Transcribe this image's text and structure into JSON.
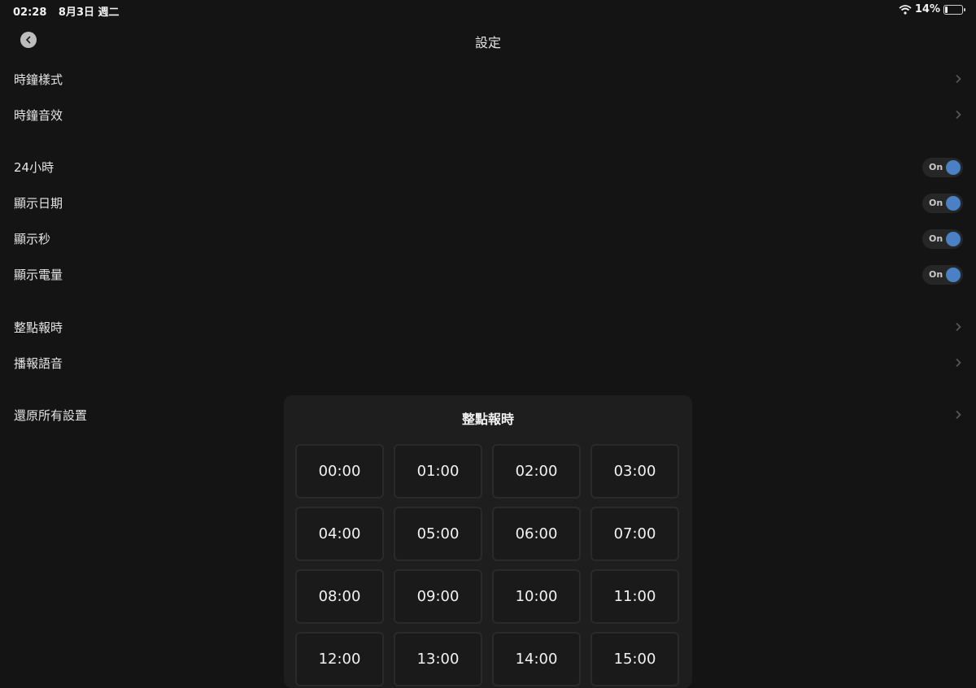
{
  "status": {
    "time": "02:28",
    "date": "8月3日 週二",
    "battery_text": "14%",
    "battery_level": 0.14
  },
  "header": {
    "title": "設定"
  },
  "settings": {
    "clock_style": "時鐘樣式",
    "clock_sound": "時鐘音效",
    "hour24": {
      "label": "24小時",
      "state": "On"
    },
    "show_date": {
      "label": "顯示日期",
      "state": "On"
    },
    "show_seconds": {
      "label": "顯示秒",
      "state": "On"
    },
    "show_battery": {
      "label": "顯示電量",
      "state": "On"
    },
    "hourly_chime": "整點報時",
    "voice": "播報語音",
    "reset": "還原所有設置"
  },
  "popup": {
    "title": "整點報時",
    "hours": [
      "00:00",
      "01:00",
      "02:00",
      "03:00",
      "04:00",
      "05:00",
      "06:00",
      "07:00",
      "08:00",
      "09:00",
      "10:00",
      "11:00",
      "12:00",
      "13:00",
      "14:00",
      "15:00"
    ]
  },
  "colors": {
    "background": "#141414",
    "accent": "#4a80c4",
    "popup_bg": "#1e1e1e"
  }
}
